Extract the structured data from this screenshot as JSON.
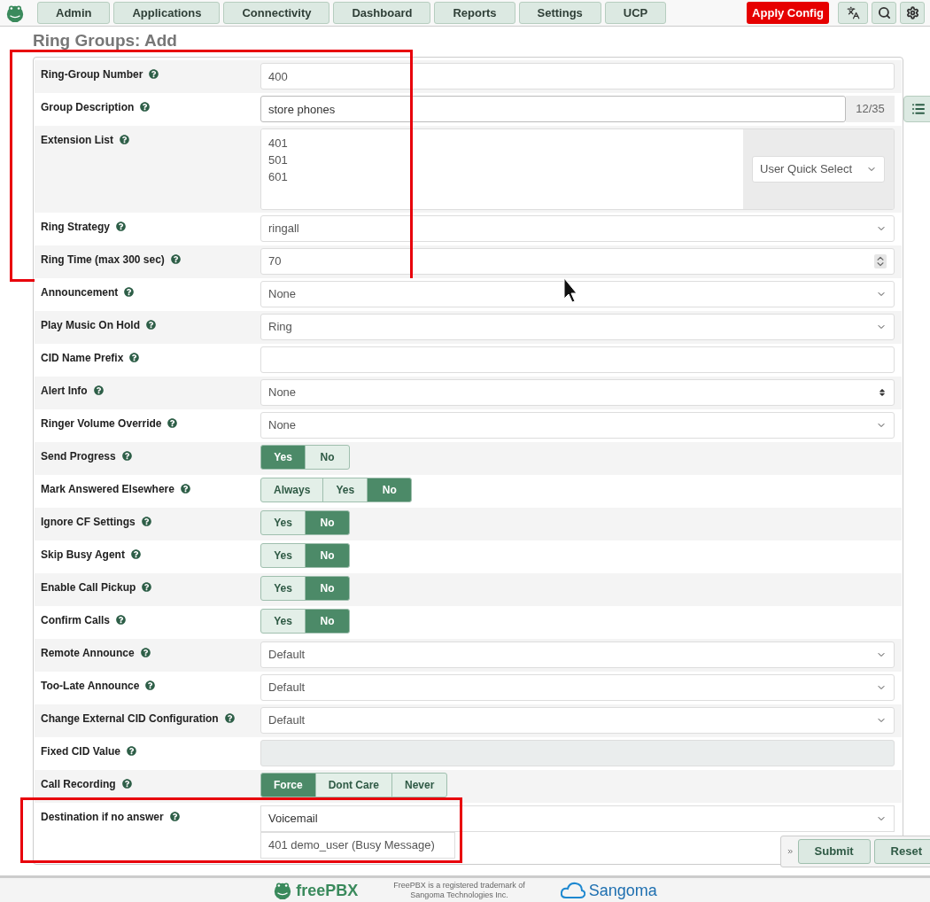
{
  "nav": {
    "tabs": [
      {
        "label": "Admin"
      },
      {
        "label": "Applications"
      },
      {
        "label": "Connectivity"
      },
      {
        "label": "Dashboard"
      },
      {
        "label": "Reports"
      },
      {
        "label": "Settings"
      },
      {
        "label": "UCP"
      }
    ],
    "apply_button": "Apply Config"
  },
  "page_title": "Ring Groups: Add",
  "rows": [
    {
      "label": "Ring-Group Number",
      "kind": "text",
      "value": "400",
      "outlined": true
    },
    {
      "label": "Group Description",
      "kind": "counter",
      "value": "store phones",
      "counter": "12/35",
      "outlined": true
    },
    {
      "label": "Extension List",
      "kind": "extensions",
      "lines": [
        "401",
        "501",
        "601"
      ],
      "quick_select": "User Quick Select",
      "outlined": true
    },
    {
      "label": "Ring Strategy",
      "kind": "select",
      "value": "ringall",
      "outlined": true
    },
    {
      "label": "Ring Time (max 300 sec)",
      "kind": "number",
      "value": "70",
      "outlined": true
    },
    {
      "label": "Announcement",
      "kind": "select",
      "value": "None",
      "outlined": false
    },
    {
      "label": "Play Music On Hold",
      "kind": "select",
      "value": "Ring",
      "outlined": false
    },
    {
      "label": "CID Name Prefix",
      "kind": "text",
      "outlined": false
    },
    {
      "label": "Alert Info",
      "kind": "sort-select",
      "value": "None",
      "outlined": false
    },
    {
      "label": "Ringer Volume Override",
      "kind": "select",
      "value": "None",
      "outlined": false
    },
    {
      "label": "Send Progress",
      "kind": "toggle",
      "options": [
        {
          "label": "Yes",
          "selected": true
        },
        {
          "label": "No",
          "selected": false
        }
      ],
      "outlined": false
    },
    {
      "label": "Mark Answered Elsewhere",
      "kind": "toggle",
      "options": [
        {
          "label": "Always",
          "selected": false
        },
        {
          "label": "Yes",
          "selected": false
        },
        {
          "label": "No",
          "selected": true
        }
      ],
      "outlined": false
    },
    {
      "label": "Ignore CF Settings",
      "kind": "toggle",
      "options": [
        {
          "label": "Yes",
          "selected": false
        },
        {
          "label": "No",
          "selected": true
        }
      ],
      "outlined": false
    },
    {
      "label": "Skip Busy Agent",
      "kind": "toggle",
      "options": [
        {
          "label": "Yes",
          "selected": false
        },
        {
          "label": "No",
          "selected": true
        }
      ],
      "outlined": false
    },
    {
      "label": "Enable Call Pickup",
      "kind": "toggle",
      "options": [
        {
          "label": "Yes",
          "selected": false
        },
        {
          "label": "No",
          "selected": true
        }
      ],
      "outlined": false
    },
    {
      "label": "Confirm Calls",
      "kind": "toggle",
      "options": [
        {
          "label": "Yes",
          "selected": false
        },
        {
          "label": "No",
          "selected": true
        }
      ],
      "outlined": false
    },
    {
      "label": "Remote Announce",
      "kind": "select",
      "value": "Default",
      "outlined": false
    },
    {
      "label": "Too-Late Announce",
      "kind": "select",
      "value": "Default",
      "outlined": false
    },
    {
      "label": "Change External CID Configuration",
      "kind": "select",
      "value": "Default",
      "outlined": false
    },
    {
      "label": "Fixed CID Value",
      "kind": "disabled",
      "outlined": false
    },
    {
      "label": "Call Recording",
      "kind": "toggle",
      "options": [
        {
          "label": "Force",
          "selected": true
        },
        {
          "label": "Dont Care",
          "selected": false
        },
        {
          "label": "Never",
          "selected": false
        }
      ],
      "outlined": false
    },
    {
      "label": "Destination if no answer",
      "kind": "destination",
      "value": "Voicemail",
      "target": "401 demo_user (Busy Message)",
      "outlined": true
    }
  ],
  "actions": [
    "Submit",
    "Reset"
  ],
  "footer": {
    "logos": [
      "freePBX",
      "Sangoma"
    ],
    "trademark_lines": [
      "FreePBX is a registered trademark of",
      "Sangoma Technologies Inc."
    ]
  }
}
